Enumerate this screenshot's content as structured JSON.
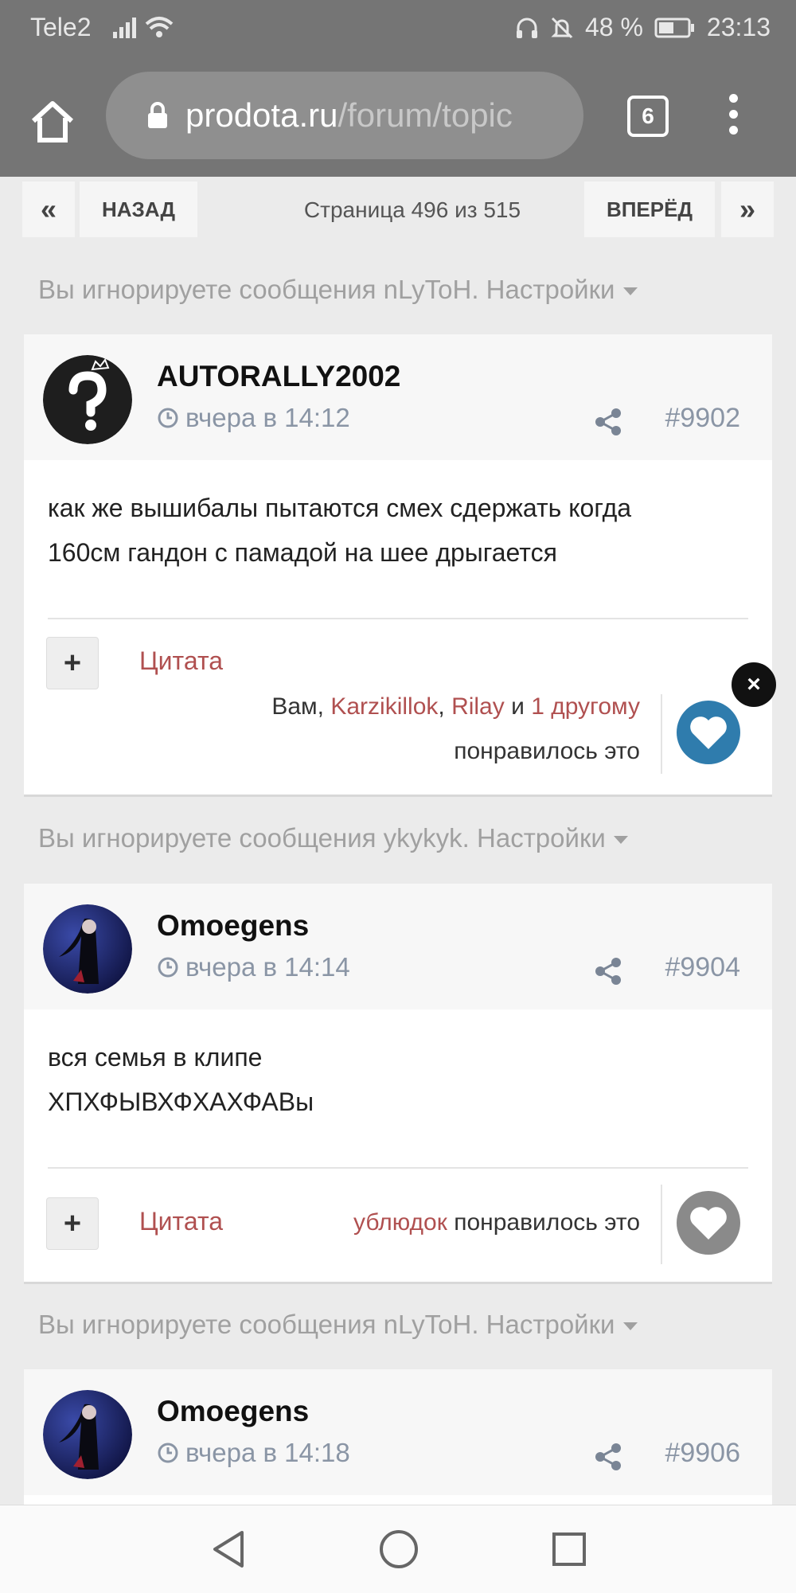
{
  "status": {
    "carrier": "Tele2",
    "battery": "48 %",
    "time": "23:13"
  },
  "browser": {
    "domain": "prodota.ru",
    "path": "/forum/topic",
    "tab_count": "6"
  },
  "pager": {
    "first": "«",
    "back": "НАЗАД",
    "info": "Страница 496 из 515",
    "next": "ВПЕРЁД",
    "last": "»"
  },
  "ignored": [
    "Вы игнорируете сообщения nLyToH. Настройки",
    "Вы игнорируете сообщения ykykyk. Настройки",
    "Вы игнорируете сообщения nLyToH. Настройки"
  ],
  "posts": [
    {
      "user": "AUTORALLY2002",
      "time": "вчера в 14:12",
      "num": "#9902",
      "lines": [
        "как же вышибалы пытаются смех сдержать когда",
        "160см гандон с памадой на шее дрыгается"
      ],
      "plus": "+",
      "quote": "Цитата",
      "likes": {
        "prefix": "Вам, ",
        "u1": "Karzikillok",
        "sep": ", ",
        "u2": "Rilay",
        "and": " и ",
        "more": "1 другому",
        "suffix": "понравилось это"
      },
      "heart_color": "#2f7cad"
    },
    {
      "user": "Omoegens",
      "time": "вчера в 14:14",
      "num": "#9904",
      "lines": [
        "вся семья в клипе",
        "ХПХФЫВХФХАХФАВы"
      ],
      "plus": "+",
      "quote": "Цитата",
      "likes": {
        "u1": "ублюдок",
        "suffix": " понравилось это"
      },
      "heart_color": "#8a8a8a"
    },
    {
      "user": "Omoegens",
      "time": "вчера в 14:18",
      "num": "#9906"
    }
  ],
  "close_label": "×"
}
